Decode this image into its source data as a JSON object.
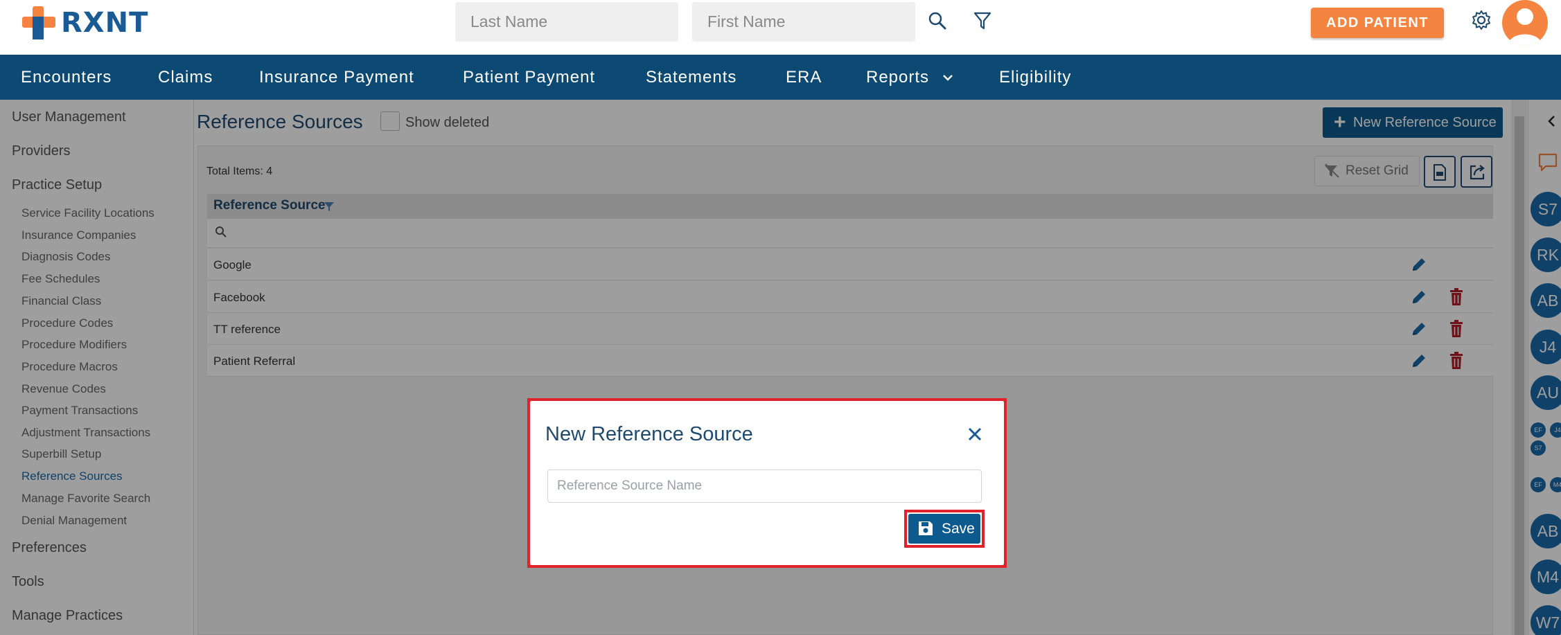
{
  "header": {
    "logo_text": "RXNT",
    "last_name_placeholder": "Last Name",
    "first_name_placeholder": "First Name",
    "add_patient_label": "ADD PATIENT"
  },
  "nav": {
    "items": [
      "Encounters",
      "Claims",
      "Insurance Payment",
      "Patient Payment",
      "Statements",
      "ERA",
      "Reports",
      "Eligibility"
    ]
  },
  "sidebar": {
    "user_management": "User Management",
    "providers": "Providers",
    "practice_setup": "Practice Setup",
    "sub_items": [
      "Service Facility Locations",
      "Insurance Companies",
      "Diagnosis Codes",
      "Fee Schedules",
      "Financial Class",
      "Procedure Codes",
      "Procedure Modifiers",
      "Procedure Macros",
      "Revenue Codes",
      "Payment Transactions",
      "Adjustment Transactions",
      "Superbill Setup",
      "Reference Sources",
      "Manage Favorite Search",
      "Denial Management"
    ],
    "active_item": "Reference Sources",
    "preferences": "Preferences",
    "tools": "Tools",
    "manage_practices": "Manage Practices"
  },
  "main": {
    "title": "Reference Sources",
    "show_deleted_label": "Show deleted",
    "new_button_label": "New Reference Source",
    "total_items": "Total Items: 4",
    "reset_grid_label": "Reset Grid",
    "column_header": "Reference Source",
    "rows": [
      "Google",
      "Facebook",
      "TT reference",
      "Patient Referral"
    ]
  },
  "right_rail": {
    "big_chips": [
      "S7",
      "RK",
      "AB",
      "J4",
      "AU",
      "AB",
      "M4",
      "W7"
    ],
    "small_chips": [
      "EF",
      "J4",
      "S7",
      "EF",
      "M4"
    ]
  },
  "modal": {
    "title": "New Reference Source",
    "input_placeholder": "Reference Source Name",
    "save_label": "Save"
  },
  "colors": {
    "brand_blue": "#0d4a73",
    "accent_orange": "#f4843f",
    "highlight_red": "#e0232a",
    "delete_red": "#b3202a"
  }
}
